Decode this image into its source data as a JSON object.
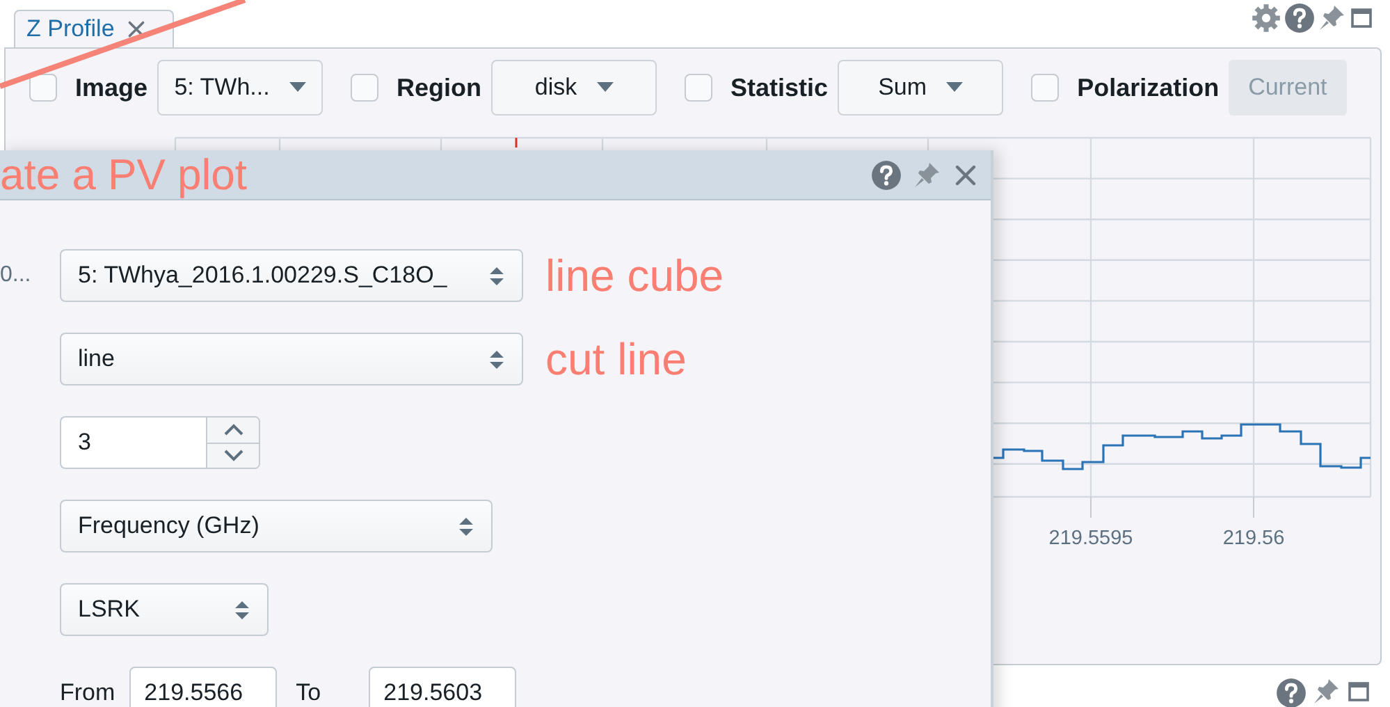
{
  "tab": {
    "label": "Z Profile"
  },
  "toolbar": [
    {
      "kind": "dropdown",
      "checked": false,
      "label": "Image",
      "value": "5: TWh..."
    },
    {
      "kind": "dropdown",
      "checked": false,
      "label": "Region",
      "value": "disk"
    },
    {
      "kind": "dropdown",
      "checked": false,
      "label": "Statistic",
      "value": "Sum"
    },
    {
      "kind": "button",
      "checked": false,
      "label": "Polarization",
      "value": "Current",
      "disabled": true
    }
  ],
  "chart": {
    "xtick_labels": [
      "219.5595",
      "219.56"
    ]
  },
  "dialog": {
    "title": "ate a PV plot",
    "fields": [
      {
        "kind": "select",
        "label": "0...",
        "value": "5: TWhya_2016.1.00229.S_C18O_",
        "annotation": "line cube"
      },
      {
        "kind": "select",
        "value": "line",
        "annotation": "cut line"
      },
      {
        "kind": "spinner",
        "value": "3"
      },
      {
        "kind": "select",
        "value": "Frequency (GHz)"
      },
      {
        "kind": "select",
        "value": "LSRK"
      },
      {
        "kind": "range",
        "from_label": "From",
        "from": "219.5566",
        "to_label": "To",
        "to": "219.5603"
      }
    ]
  }
}
